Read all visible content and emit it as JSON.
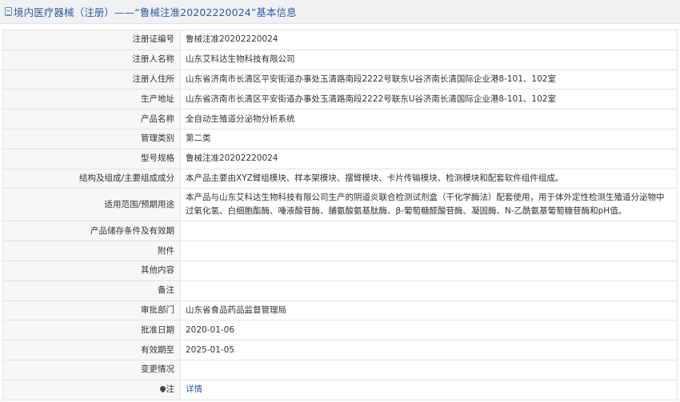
{
  "header": {
    "title": "境内医疗器械（注册）——“鲁械注准20202220024”基本信息"
  },
  "rows": [
    {
      "label": "注册证编号",
      "value": "鲁械注准20202220024"
    },
    {
      "label": "注册人名称",
      "value": "山东艾科达生物科技有限公司"
    },
    {
      "label": "注册人住所",
      "value": "山东省济南市长清区平安街道办事处玉清路南段2222号联东U谷济南长清国际企业港8-101、102室"
    },
    {
      "label": "生产地址",
      "value": "山东省济南市长清区平安街道办事处玉清路南段2222号联东U谷济南长清国际企业港8-101、102室"
    },
    {
      "label": "产品名称",
      "value": "全自动生殖道分泌物分析系统"
    },
    {
      "label": "管理类别",
      "value": "第二类"
    },
    {
      "label": "型号规格",
      "value": "鲁械注准20202220024"
    },
    {
      "label": "结构及组成/主要组成成分",
      "value": "本产品主要由XYZ臂组模块、样本架模块、摆臂模块、卡片传输模块、检测模块和配套软件组件组成。"
    },
    {
      "label": "适用范围/预期用途",
      "value": "本产品与山东艾科达生物科技有限公司生产的阴道炎联合检测试剂盒（干化学酶法）配套使用，用于体外定性检测生殖道分泌物中过氧化氢、白细胞酯酶、唾液酸苷酶、脯氨酸氨基肽酶、β-葡萄糖醛酸苷酶、凝固酶、N-乙酰氨基葡萄糖苷酶和pH值。"
    },
    {
      "label": "产品储存条件及有效期",
      "value": ""
    },
    {
      "label": "附件",
      "value": ""
    },
    {
      "label": "其他内容",
      "value": ""
    },
    {
      "label": "备注",
      "value": ""
    },
    {
      "label": "审批部门",
      "value": "山东省食品药品监督管理局"
    },
    {
      "label": "批准日期",
      "value": "2020-01-06"
    },
    {
      "label": "有效期至",
      "value": "2025-01-05"
    },
    {
      "label": "变更情况",
      "value": ""
    }
  ],
  "note_row": {
    "label": "注",
    "link_text": "详情"
  }
}
